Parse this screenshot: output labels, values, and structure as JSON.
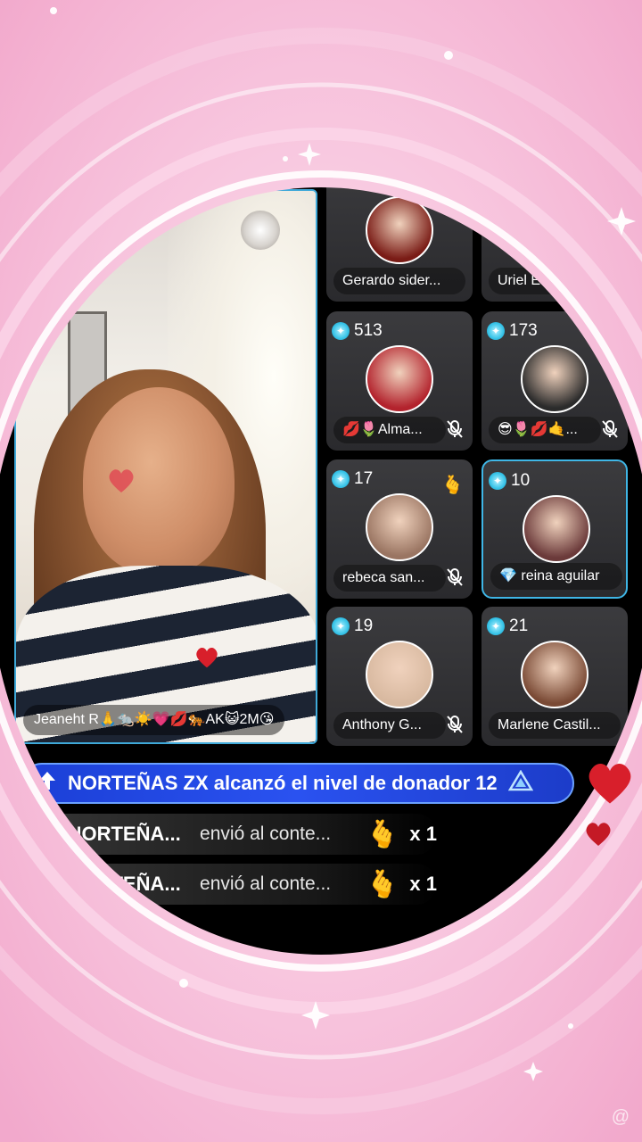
{
  "host": {
    "name": "Jeaneht R🙏🐀☀️💗💋🐅AK😺2M😘"
  },
  "guests": [
    {
      "score": "",
      "name": "Gerardo sider...",
      "muted": false,
      "hand": false,
      "avatar_color": "#7a1c16"
    },
    {
      "score": "",
      "name": "Uriel Estre...",
      "muted": false,
      "hand": false,
      "avatar_color": "#444"
    },
    {
      "score": "513",
      "name": "💋🌷Alma...",
      "muted": true,
      "hand": false,
      "avatar_color": "#b3232d"
    },
    {
      "score": "173",
      "name": "😎🌷💋🤙...",
      "muted": true,
      "hand": false,
      "avatar_color": "#2b2b2b"
    },
    {
      "score": "17",
      "name": "rebeca san...",
      "muted": true,
      "hand": true,
      "avatar_color": "#9a7562"
    },
    {
      "score": "10",
      "name": "💎 reina aguilar",
      "muted": false,
      "hand": false,
      "avatar_color": "#6b3a3a"
    },
    {
      "score": "19",
      "name": "Anthony G...",
      "muted": true,
      "hand": false,
      "avatar_color": "#d8b9a0"
    },
    {
      "score": "21",
      "name": "Marlene Castil...",
      "muted": false,
      "hand": false,
      "avatar_color": "#7a4a35"
    }
  ],
  "hand_icon": "🫰",
  "banner": {
    "text": "NORTEÑAS ZX alcanzó el nivel de donador 12",
    "icon_up": "arrow-up-icon",
    "icon_end": "triangle-badge-icon"
  },
  "gifts": [
    {
      "user": "NORTEÑA...",
      "action": "envió al conte...",
      "icon": "🫰",
      "count": "x 1"
    },
    {
      "user": "NORTEÑA...",
      "action": "envió al conte...",
      "icon": "🫰",
      "count": "x 1"
    }
  ],
  "colors": {
    "frame_pink": "#f6bfdc",
    "frame_light": "#fde6f1",
    "accent_blue": "#3fb6e6",
    "banner_blue": "#2a52f0",
    "heart_red": "#d81f2b"
  },
  "watermark": "@"
}
